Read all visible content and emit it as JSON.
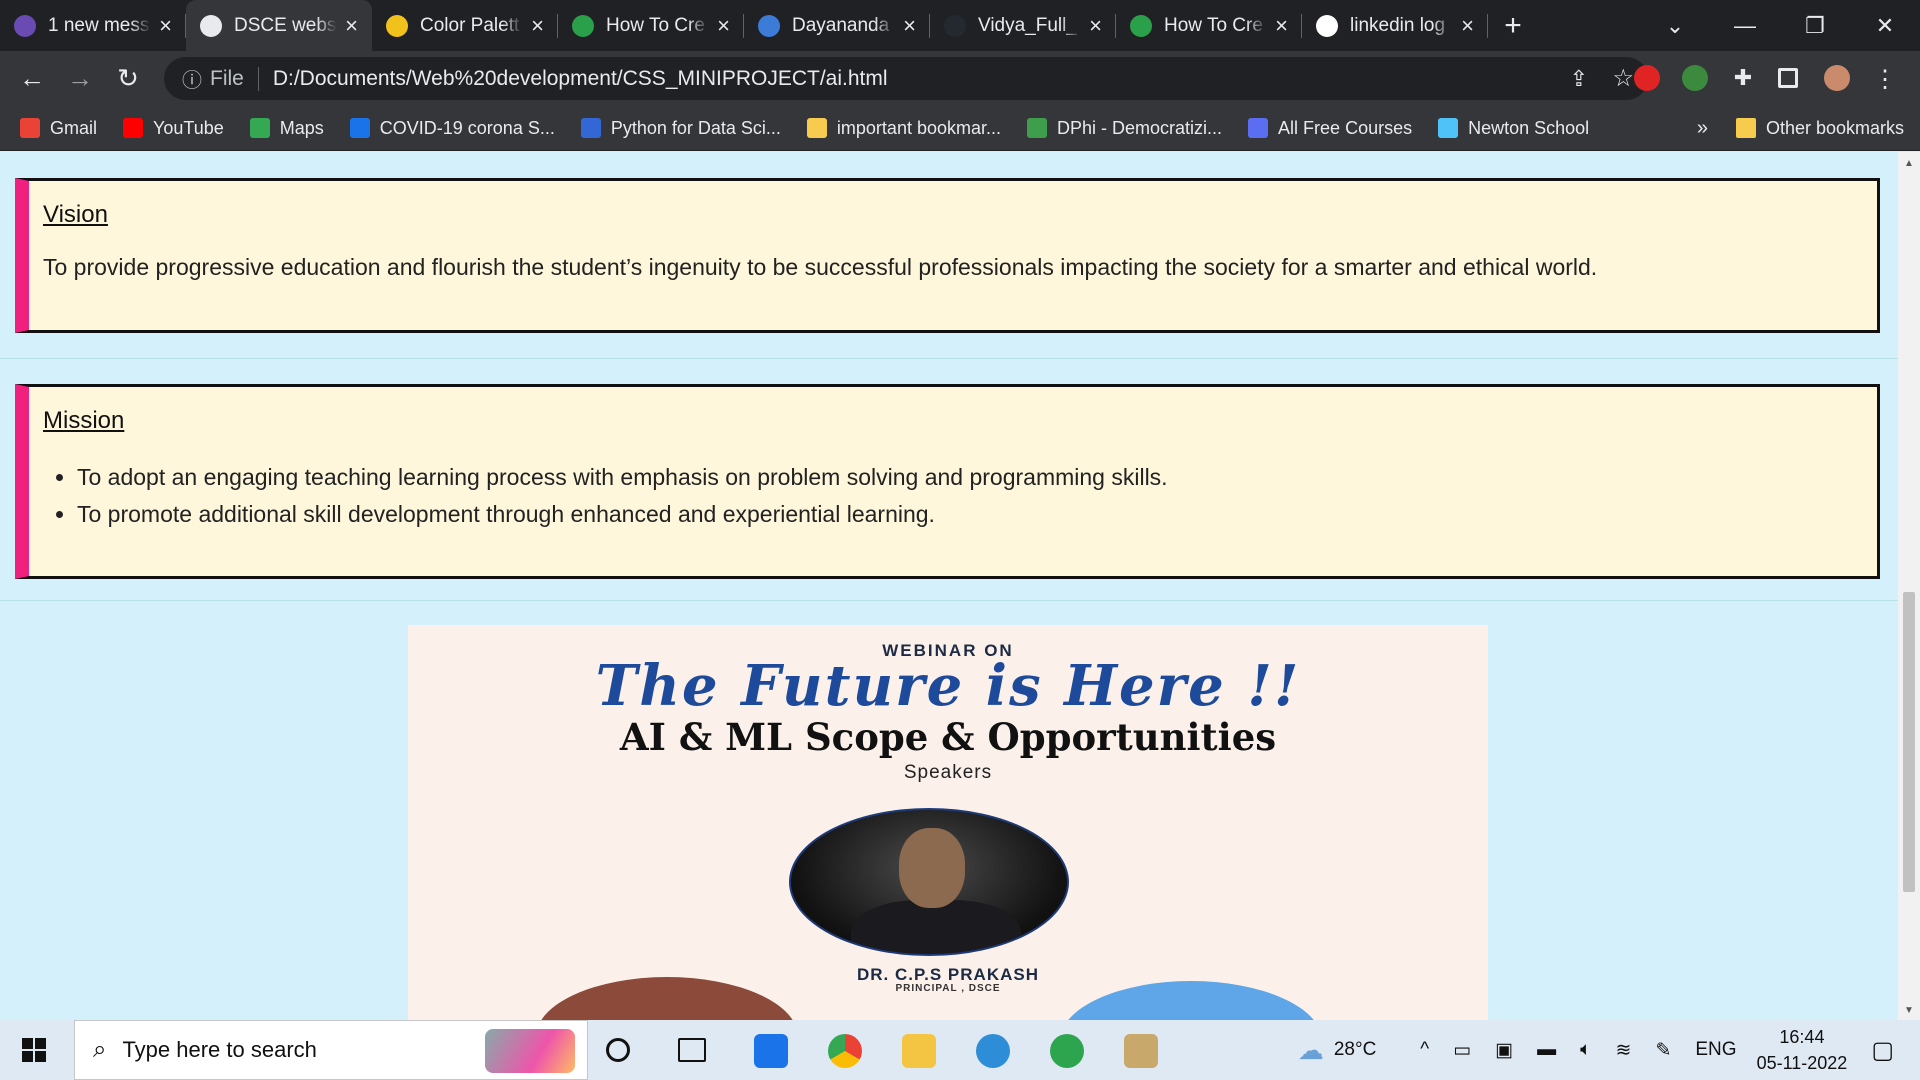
{
  "tabs": [
    {
      "title": "1 new mess",
      "fav": "#6a4bb3"
    },
    {
      "title": "DSCE websi",
      "fav": "#e8eaed",
      "active": true
    },
    {
      "title": "Color Palett",
      "fav": "#f1c21b"
    },
    {
      "title": "How To Cre",
      "fav": "#2ba04a"
    },
    {
      "title": "Dayananda",
      "fav": "#3d7bd9"
    },
    {
      "title": "Vidya_Full_",
      "fav": "#24292f"
    },
    {
      "title": "How To Cre",
      "fav": "#2ba04a"
    },
    {
      "title": "linkedin log",
      "fav": "#ffffff"
    }
  ],
  "toolbar": {
    "file_label": "File",
    "url": "D:/Documents/Web%20development/CSS_MINIPROJECT/ai.html"
  },
  "bookmarks": [
    {
      "label": "Gmail",
      "color": "#ea4335"
    },
    {
      "label": "YouTube",
      "color": "#ff0000"
    },
    {
      "label": "Maps",
      "color": "#34a853"
    },
    {
      "label": "COVID-19 corona S...",
      "color": "#1a73e8"
    },
    {
      "label": "Python for Data Sci...",
      "color": "#3367d6"
    },
    {
      "label": "important bookmar...",
      "color": "#f7cb4d"
    },
    {
      "label": "DPhi - Democratizi...",
      "color": "#3f9e4b"
    },
    {
      "label": "All Free Courses",
      "color": "#5b6df0"
    },
    {
      "label": "Newton School",
      "color": "#4fc3f7"
    }
  ],
  "bookmarks_more": "»",
  "bookmarks_other": "Other bookmarks",
  "vision": {
    "heading": "Vision",
    "text": "To provide progressive education and flourish the student’s ingenuity to be successful professionals impacting the society for a smarter and ethical world."
  },
  "mission": {
    "heading": "Mission",
    "items": [
      "To adopt an engaging teaching learning process with emphasis on problem solving and programming skills.",
      "To promote additional skill development through enhanced and experiential learning."
    ]
  },
  "poster": {
    "line1": "WEBINAR ON",
    "line2": "The Future is Here !!",
    "line3": "AI & ML Scope & Opportunities",
    "line4": "Speakers",
    "speaker_name": "DR. C.P.S PRAKASH",
    "speaker_role": "PRINCIPAL , DSCE"
  },
  "taskbar": {
    "search_placeholder": "Type here to search",
    "weather": "28°C",
    "lang": "ENG",
    "time": "16:44",
    "date": "05-11-2022"
  }
}
